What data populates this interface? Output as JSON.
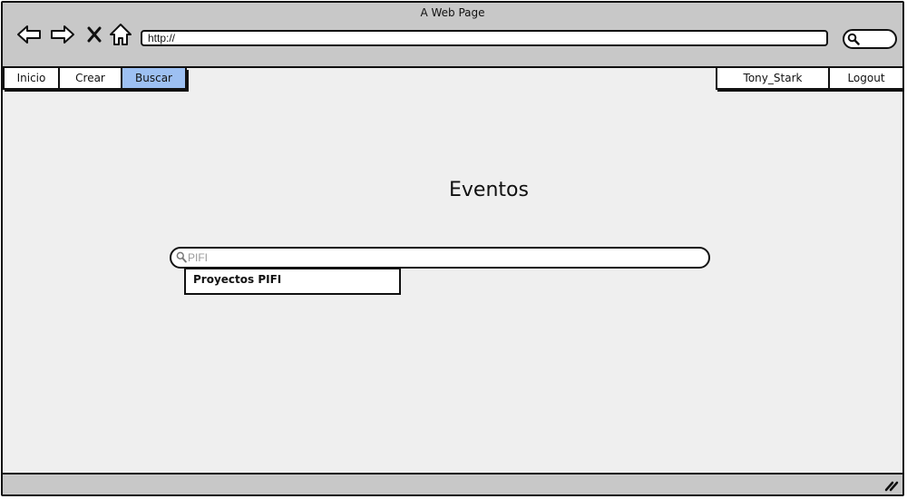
{
  "window": {
    "title": "A Web Page"
  },
  "toolbar": {
    "back_icon": "arrow-left-icon",
    "forward_icon": "arrow-right-icon",
    "stop_icon": "close-icon",
    "home_icon": "home-icon",
    "url": "http://",
    "search_icon": "search-icon"
  },
  "nav": {
    "left_tabs": [
      {
        "label": "Inicio"
      },
      {
        "label": "Crear"
      },
      {
        "label": "Buscar",
        "active": true
      }
    ],
    "right_tabs": [
      {
        "label": "Tony_Stark"
      },
      {
        "label": "Logout"
      }
    ],
    "active_color": "#9dc0f2"
  },
  "main": {
    "heading": "Eventos",
    "search": {
      "value": "PIFI"
    },
    "suggestions": [
      {
        "label": "Proyectos PIFI"
      }
    ]
  },
  "colors": {
    "chrome": "#c8c8c8",
    "canvas": "#efefef",
    "ink": "#111111"
  }
}
